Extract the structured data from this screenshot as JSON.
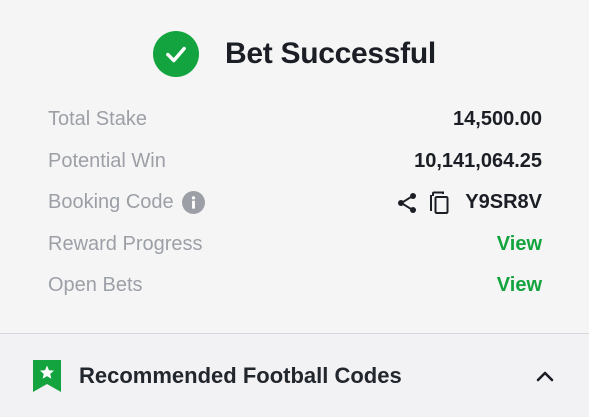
{
  "header": {
    "title": "Bet Successful",
    "icon": "check-circle-icon",
    "accent": "#14a43f"
  },
  "rows": [
    {
      "label": "Total Stake",
      "value": "14,500.00"
    },
    {
      "label": "Potential Win",
      "value": "10,141,064.25"
    },
    {
      "label": "Booking Code",
      "value": "Y9SR8V"
    },
    {
      "label": "Reward Progress",
      "value": "View"
    },
    {
      "label": "Open Bets",
      "value": "View"
    }
  ],
  "recommended": {
    "title": "Recommended Football Codes",
    "icon": "bookmark-star-icon"
  }
}
